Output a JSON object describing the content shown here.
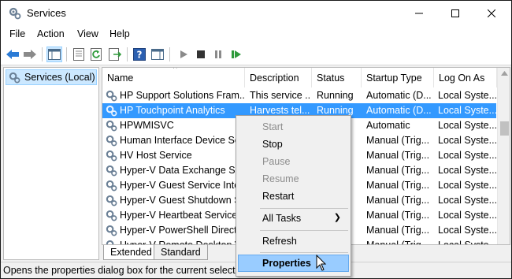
{
  "window": {
    "title": "Services",
    "icon": "gear-icon"
  },
  "menubar": [
    "File",
    "Action",
    "View",
    "Help"
  ],
  "left_pane": {
    "tree_item": "Services (Local)"
  },
  "columns": [
    "Name",
    "Description",
    "Status",
    "Startup Type",
    "Log On As"
  ],
  "rows": [
    {
      "name": "HP Support Solutions Fram...",
      "desc": "This service ...",
      "status": "Running",
      "startup": "Automatic (D...",
      "logon": "Local Syste...",
      "selected": false
    },
    {
      "name": "HP Touchpoint Analytics",
      "desc": "Harvests tel...",
      "status": "Running",
      "startup": "Automatic (D...",
      "logon": "Local Syste...",
      "selected": true
    },
    {
      "name": "HPWMISVC",
      "desc": "",
      "status": "",
      "startup": "Automatic",
      "logon": "Local Syste...",
      "selected": false
    },
    {
      "name": "Human Interface Device Ser",
      "desc": "",
      "status": "",
      "startup": "Manual (Trig...",
      "logon": "Local Syste...",
      "selected": false
    },
    {
      "name": "HV Host Service",
      "desc": "",
      "status": "",
      "startup": "Manual (Trig...",
      "logon": "Local Syste...",
      "selected": false
    },
    {
      "name": "Hyper-V Data Exchange Ser",
      "desc": "",
      "status": "",
      "startup": "Manual (Trig...",
      "logon": "Local Syste...",
      "selected": false
    },
    {
      "name": "Hyper-V Guest Service Inter",
      "desc": "",
      "status": "",
      "startup": "Manual (Trig...",
      "logon": "Local Syste...",
      "selected": false
    },
    {
      "name": "Hyper-V Guest Shutdown S",
      "desc": "",
      "status": "",
      "startup": "Manual (Trig...",
      "logon": "Local Syste...",
      "selected": false
    },
    {
      "name": "Hyper-V Heartbeat Service",
      "desc": "",
      "status": "",
      "startup": "Manual (Trig...",
      "logon": "Local Syste...",
      "selected": false
    },
    {
      "name": "Hyper-V PowerShell Direct",
      "desc": "",
      "status": "",
      "startup": "Manual (Trig...",
      "logon": "Local Syste...",
      "selected": false
    },
    {
      "name": "Hyper-V Remote Desktop V",
      "desc": "",
      "status": "",
      "startup": "Manual (Trig...",
      "logon": "Local Syste...",
      "selected": false
    }
  ],
  "tabs": [
    "Extended",
    "Standard"
  ],
  "statusbar": "Opens the properties dialog box for the current selection.",
  "context_menu": [
    {
      "label": "Start",
      "state": "disabled"
    },
    {
      "label": "Stop",
      "state": "enabled"
    },
    {
      "label": "Pause",
      "state": "disabled"
    },
    {
      "label": "Resume",
      "state": "disabled"
    },
    {
      "label": "Restart",
      "state": "enabled"
    },
    {
      "separator": true
    },
    {
      "label": "All Tasks",
      "state": "enabled",
      "submenu": true
    },
    {
      "separator": true
    },
    {
      "label": "Refresh",
      "state": "enabled"
    },
    {
      "separator": true
    },
    {
      "label": "Properties",
      "state": "hover"
    }
  ],
  "colors": {
    "selection": "#3399ff",
    "menu_hover": "#99ccff",
    "toolbar_blue": "#2b7bd6",
    "toolbar_green": "#2e9a3a"
  }
}
